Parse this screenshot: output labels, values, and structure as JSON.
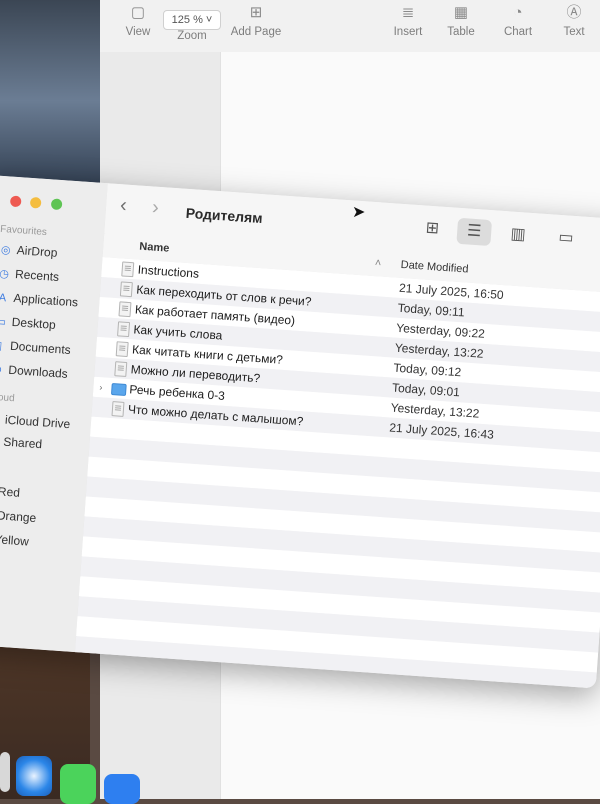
{
  "pages_toolbar": {
    "view_label": "View",
    "zoom_label": "Zoom",
    "zoom_value": "125 %",
    "add_page_label": "Add Page",
    "insert_label": "Insert",
    "table_label": "Table",
    "chart_label": "Chart",
    "text_label": "Text"
  },
  "finder": {
    "title": "Родителям",
    "sidebar": {
      "favourites_heading": "Favourites",
      "favourites": [
        {
          "label": "AirDrop",
          "icon": "airdrop-icon"
        },
        {
          "label": "Recents",
          "icon": "clock-icon"
        },
        {
          "label": "Applications",
          "icon": "applications-icon"
        },
        {
          "label": "Desktop",
          "icon": "desktop-icon"
        },
        {
          "label": "Documents",
          "icon": "document-icon"
        },
        {
          "label": "Downloads",
          "icon": "download-icon"
        }
      ],
      "icloud_heading": "Cloud",
      "icloud": [
        {
          "label": "iCloud Drive",
          "icon": "cloud-icon"
        },
        {
          "label": "Shared",
          "icon": "shared-folder-icon"
        }
      ],
      "tags_heading": "ags",
      "tags": [
        {
          "label": "Red",
          "color": "#e5463b"
        },
        {
          "label": "Orange",
          "color": "#f39a2b"
        },
        {
          "label": "Yellow",
          "color": "#f2cd2e"
        }
      ]
    },
    "columns": {
      "name": "Name",
      "date_modified": "Date Modified"
    },
    "files": [
      {
        "name": "Instructions",
        "date": "21 July 2025, 16:50",
        "kind": "doc"
      },
      {
        "name": "Как переходить от слов к речи?",
        "date": "Today, 09:11",
        "kind": "doc"
      },
      {
        "name": "Как работает память (видео)",
        "date": "Yesterday, 09:22",
        "kind": "doc"
      },
      {
        "name": "Как учить слова",
        "date": "Yesterday, 13:22",
        "kind": "doc"
      },
      {
        "name": "Как читать книги с детьми?",
        "date": "Today, 09:12",
        "kind": "doc"
      },
      {
        "name": "Можно ли переводить?",
        "date": "Today, 09:01",
        "kind": "doc"
      },
      {
        "name": "Речь ребенка 0-3",
        "date": "Yesterday, 13:22",
        "kind": "folder"
      },
      {
        "name": "Что можно делать с малышом?",
        "date": "21 July 2025, 16:43",
        "kind": "doc"
      }
    ]
  }
}
